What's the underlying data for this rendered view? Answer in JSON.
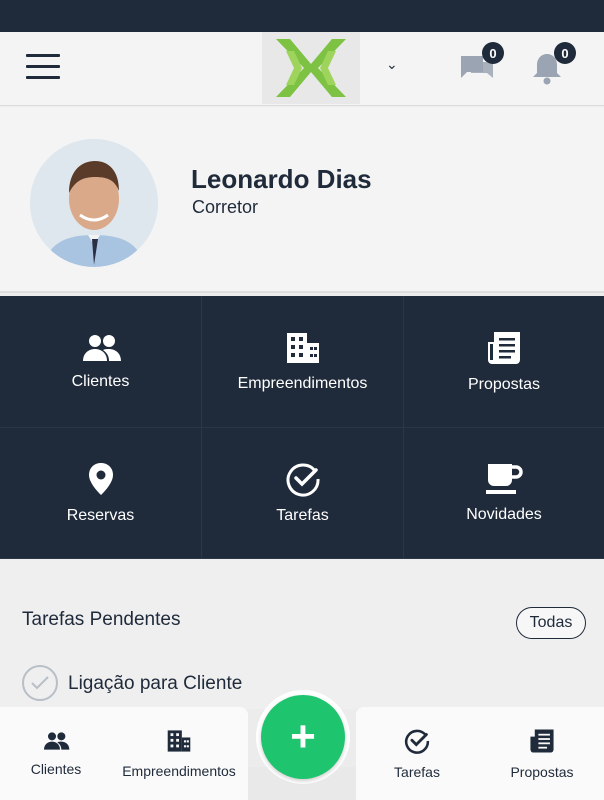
{
  "header": {
    "notifications": {
      "messages_count": "0",
      "alerts_count": "0"
    }
  },
  "profile": {
    "name": "Leonardo Dias",
    "role": "Corretor"
  },
  "menu": [
    {
      "label": "Clientes",
      "icon": "people-icon"
    },
    {
      "label": "Empreendimentos",
      "icon": "building-icon"
    },
    {
      "label": "Propostas",
      "icon": "document-icon"
    },
    {
      "label": "Reservas",
      "icon": "location-pin-icon"
    },
    {
      "label": "Tarefas",
      "icon": "check-circle-icon"
    },
    {
      "label": "Novidades",
      "icon": "coffee-cup-icon"
    }
  ],
  "tasks": {
    "title": "Tarefas Pendentes",
    "all_button": "Todas",
    "items": [
      {
        "label": "Ligação para Cliente"
      }
    ]
  },
  "bottom_nav": [
    {
      "label": "Clientes",
      "icon": "people-icon"
    },
    {
      "label": "Empreendimentos",
      "icon": "building-icon"
    },
    {
      "label": "Tarefas",
      "icon": "check-circle-icon"
    },
    {
      "label": "Propostas",
      "icon": "document-icon"
    }
  ],
  "fab": {
    "symbol": "+"
  },
  "colors": {
    "primary": "#1f2a3a",
    "accent": "#1fc46f",
    "logo_green": "#7dc242"
  }
}
